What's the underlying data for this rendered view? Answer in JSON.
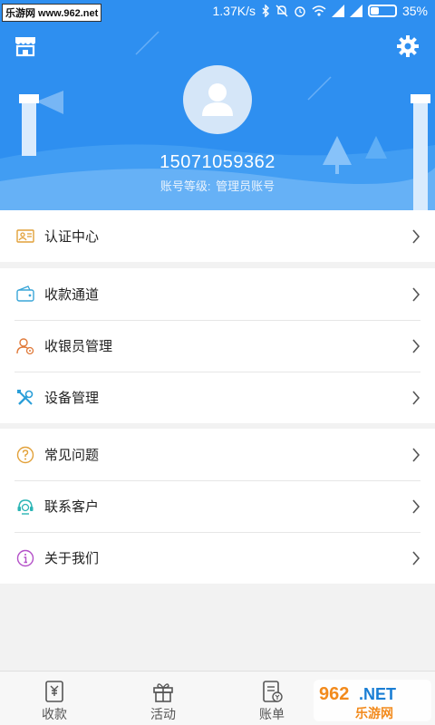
{
  "status": {
    "watermark": "乐游网 www.962.net",
    "speed": "1.37K/s",
    "battery_text": "35%",
    "battery_level": 0.35
  },
  "header": {
    "left_icon": "store-icon",
    "right_icon": "gear-icon",
    "avatar_icon": "user-icon",
    "phone": "15071059362",
    "level_label": "账号等级:",
    "level_value": "管理员账号"
  },
  "menu": {
    "group1": [
      {
        "label": "认证中心",
        "icon": "certificate-icon",
        "color": "#e2a13a"
      }
    ],
    "group2": [
      {
        "label": "收款通道",
        "icon": "wallet-icon",
        "color": "#3aa6d8"
      },
      {
        "label": "收银员管理",
        "icon": "cashier-icon",
        "color": "#e07a3a"
      },
      {
        "label": "设备管理",
        "icon": "tools-icon",
        "color": "#2a9ed8"
      }
    ],
    "group3": [
      {
        "label": "常见问题",
        "icon": "question-icon",
        "color": "#e2a13a"
      },
      {
        "label": "联系客户",
        "icon": "headset-icon",
        "color": "#2bb5b5"
      },
      {
        "label": "关于我们",
        "icon": "info-icon",
        "color": "#b450c8"
      }
    ]
  },
  "tabbar": {
    "tabs": [
      {
        "label": "收款",
        "icon": "receive-money-icon"
      },
      {
        "label": "活动",
        "icon": "gift-icon"
      },
      {
        "label": "账单",
        "icon": "bill-icon"
      },
      {
        "label": "",
        "icon": ""
      }
    ]
  },
  "watermark_br": "962.NET 乐游网"
}
